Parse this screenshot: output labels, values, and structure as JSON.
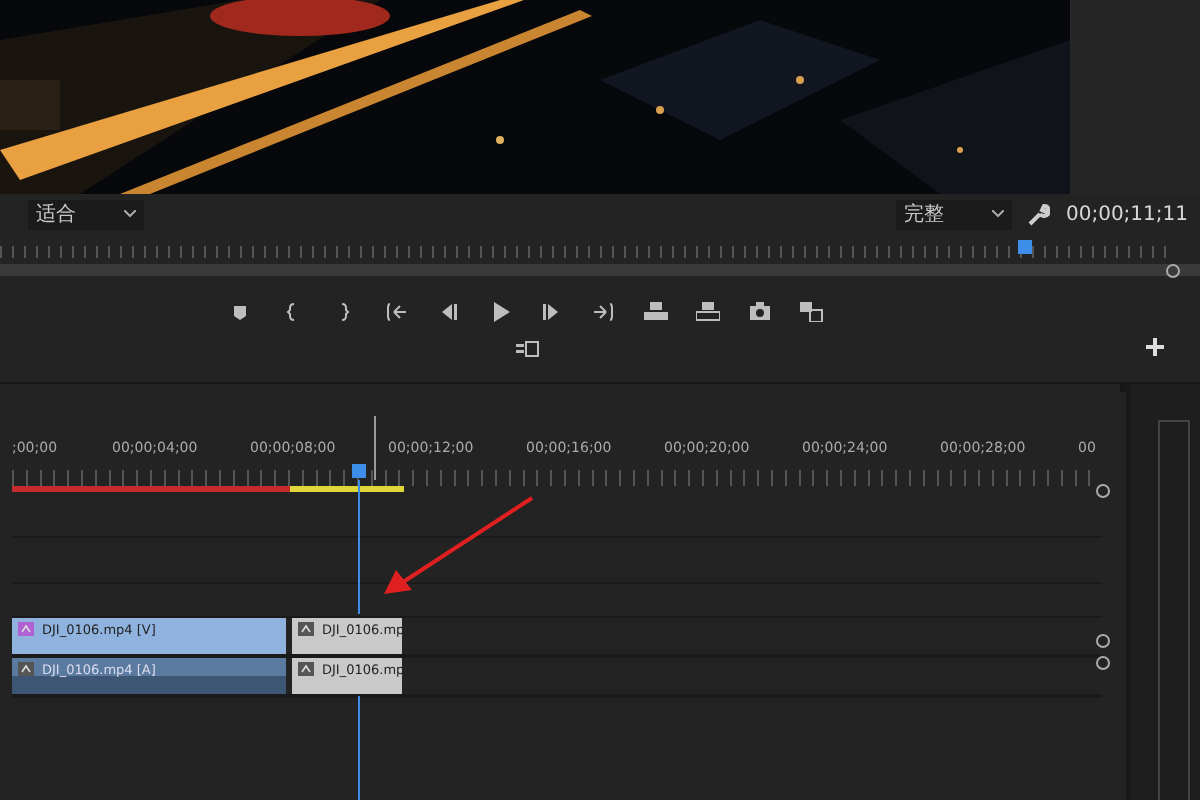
{
  "monitor": {
    "zoom_dropdown": "适合",
    "quality_dropdown": "完整",
    "timecode": "00;00;11;11"
  },
  "timeline": {
    "ruler_labels": [
      ";00;00",
      "00;00;04;00",
      "00;00;08;00",
      "00;00;12;00",
      "00;00;16;00",
      "00;00;20;00",
      "00;00;24;00",
      "00;00;28;00",
      "00"
    ],
    "tracks": [
      {
        "kind": "video",
        "clips": [
          {
            "kind": "main",
            "name": "DJI_0106.mp4 [V]"
          },
          {
            "kind": "trimmed",
            "name": "DJI_0106.mp"
          }
        ]
      },
      {
        "kind": "audio",
        "clips": [
          {
            "kind": "main",
            "name": "DJI_0106.mp4 [A]"
          },
          {
            "kind": "trimmed",
            "name": "DJI_0106.mp"
          }
        ]
      }
    ]
  }
}
